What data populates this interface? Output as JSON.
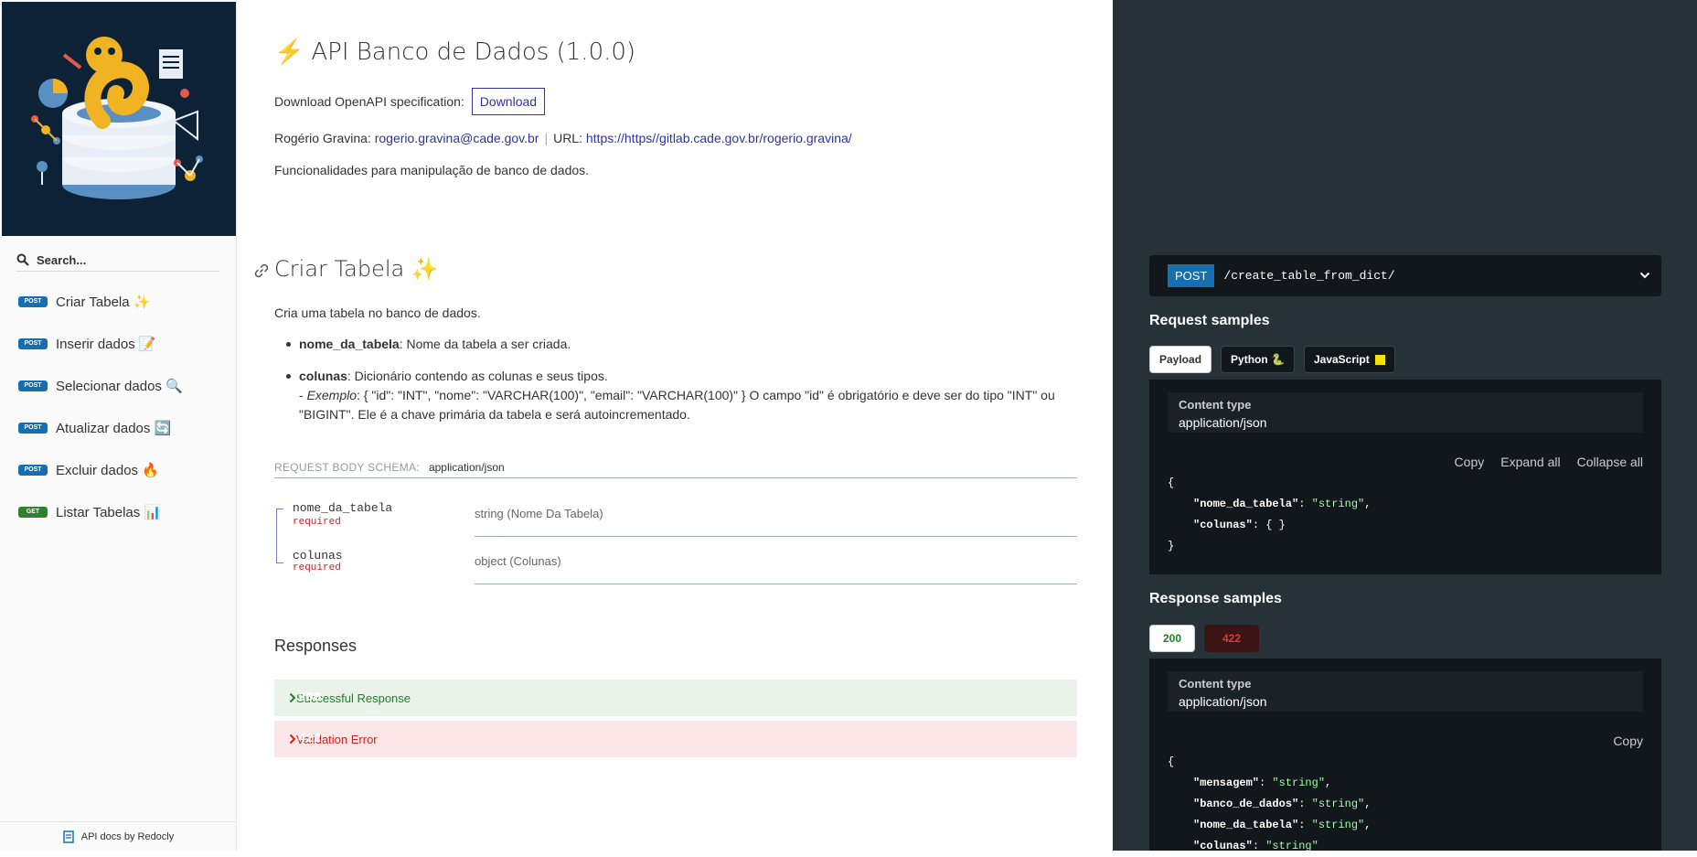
{
  "sidebar": {
    "search_placeholder": "Search...",
    "items": [
      {
        "method": "POST",
        "label": "Criar Tabela ✨"
      },
      {
        "method": "POST",
        "label": "Inserir dados 📝"
      },
      {
        "method": "POST",
        "label": "Selecionar dados 🔍"
      },
      {
        "method": "POST",
        "label": "Atualizar dados 🔄"
      },
      {
        "method": "POST",
        "label": "Excluir dados 🔥"
      },
      {
        "method": "GET",
        "label": "Listar Tabelas 📊"
      }
    ],
    "footer": "API docs by Redocly"
  },
  "info": {
    "title": "API Banco de Dados (1.0.0)",
    "title_icon": "⚡",
    "download_text": "Download OpenAPI specification:",
    "download_button": "Download",
    "author": "Rogério Gravina:",
    "email": "rogerio.gravina@cade.gov.br",
    "url_label": "URL:",
    "url": "https://https//gitlab.cade.gov.br/rogerio.gravina/",
    "description": "Funcionalidades para manipulação de banco de dados."
  },
  "operation": {
    "title": "Criar Tabela ✨",
    "description": "Cria uma tabela no banco de dados.",
    "param1_name": "nome_da_tabela",
    "param1_desc": ": Nome da tabela a ser criada.",
    "param2_name": "colunas",
    "param2_desc": ": Dicionário contendo as colunas e seus tipos.",
    "param2_example_prefix": "- ",
    "param2_example_label": "Exemplo",
    "param2_example": ": { \"id\": \"INT\", \"nome\": \"VARCHAR(100)\", \"email\": \"VARCHAR(100)\" } O campo \"id\" é obrigatório e deve ser do tipo \"INT\" ou \"BIGINT\". Ele é a chave primária da tabela e será autoincrementado.",
    "schema_label": "REQUEST BODY SCHEMA:",
    "schema_content_type": "application/json",
    "fields": [
      {
        "name": "nome_da_tabela",
        "required": "required",
        "type": "string (Nome Da Tabela)"
      },
      {
        "name": "colunas",
        "required": "required",
        "type": "object (Colunas)"
      }
    ],
    "responses_title": "Responses",
    "responses": [
      {
        "code": "200",
        "text": "Successful Response"
      },
      {
        "code": "422",
        "text": "Validation Error"
      }
    ]
  },
  "right_panel": {
    "method": "POST",
    "path": "/create_table_from_dict/",
    "request_title": "Request samples",
    "request_tabs": [
      "Payload",
      "Python 🐍",
      "JavaScript"
    ],
    "content_type_label": "Content type",
    "content_type": "application/json",
    "copy": "Copy",
    "expand_all": "Expand all",
    "collapse_all": "Collapse all",
    "request_body": {
      "open": "{",
      "line1_key": "\"nome_da_tabela\"",
      "line1_val": "\"string\"",
      "line2_key": "\"colunas\"",
      "line2_val": "{ }",
      "close": "}"
    },
    "response_title": "Response samples",
    "response_tabs": [
      "200",
      "422"
    ],
    "response_body": {
      "open": "{",
      "l1k": "\"mensagem\"",
      "l1v": "\"string\"",
      "l2k": "\"banco_de_dados\"",
      "l2v": "\"string\"",
      "l3k": "\"nome_da_tabela\"",
      "l3v": "\"string\"",
      "l4k": "\"colunas\"",
      "l4v": "\"string\""
    },
    "colors": {
      "bg": "#263238",
      "post": "#186fb0",
      "string": "#a0fbaa"
    }
  }
}
